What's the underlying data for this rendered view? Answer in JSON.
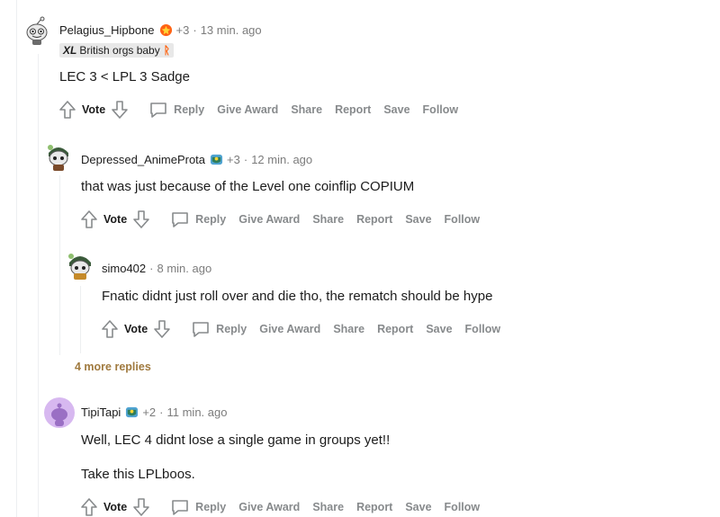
{
  "comments": [
    {
      "username": "Pelagius_Hipbone",
      "award_count": "+3",
      "separator": "·",
      "time": "13 min. ago",
      "flair_prefix": "XL",
      "flair_text": "British orgs baby",
      "flair_suffix": "ᚱ",
      "body": [
        "LEC 3 < LPL 3 Sadge"
      ]
    },
    {
      "username": "Depressed_AnimeProta",
      "award_count": "+3",
      "separator": "·",
      "time": "12 min. ago",
      "body": [
        "that was just because of the Level one coinflip COPIUM"
      ]
    },
    {
      "username": "simo402",
      "separator": "·",
      "time": "8 min. ago",
      "body": [
        "Fnatic didnt just roll over and die tho, the rematch should be hype"
      ]
    },
    {
      "username": "TipiTapi",
      "award_count": "+2",
      "separator": "·",
      "time": "11 min. ago",
      "body": [
        "Well, LEC 4 didnt lose a single game in groups yet!!",
        "Take this LPLboos."
      ]
    }
  ],
  "actions": {
    "vote": "Vote",
    "reply": "Reply",
    "give_award": "Give Award",
    "share": "Share",
    "report": "Report",
    "save": "Save",
    "follow": "Follow"
  },
  "more_replies": "4 more replies",
  "colors": {
    "accent_more": "#a07a3f",
    "action_gray": "#878a8c",
    "text": "#1c1c1c"
  },
  "icons": [
    "upvote-icon",
    "downvote-icon",
    "reply-icon",
    "award-icon",
    "snoo-avatar"
  ]
}
